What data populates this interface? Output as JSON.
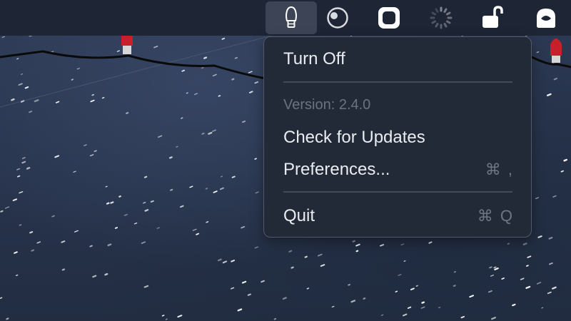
{
  "menubar": {
    "items": [
      {
        "icon": "bulb-icon",
        "active": true
      },
      {
        "icon": "circle-toggle-icon"
      },
      {
        "icon": "rounded-square-icon"
      },
      {
        "icon": "spinner-icon"
      },
      {
        "icon": "padlock-icon"
      },
      {
        "icon": "inbox-icon"
      }
    ]
  },
  "menu": {
    "turn_off": "Turn Off",
    "version": "Version: 2.4.0",
    "check_updates": "Check for Updates",
    "preferences": "Preferences...",
    "preferences_shortcut": "⌘ ,",
    "quit": "Quit",
    "quit_shortcut": "⌘ Q"
  },
  "colors": {
    "menubar_bg": "#1e2535",
    "menu_bg": "#232a37",
    "bulb_red": "#c8202a",
    "string_black": "#0a0a0a"
  }
}
